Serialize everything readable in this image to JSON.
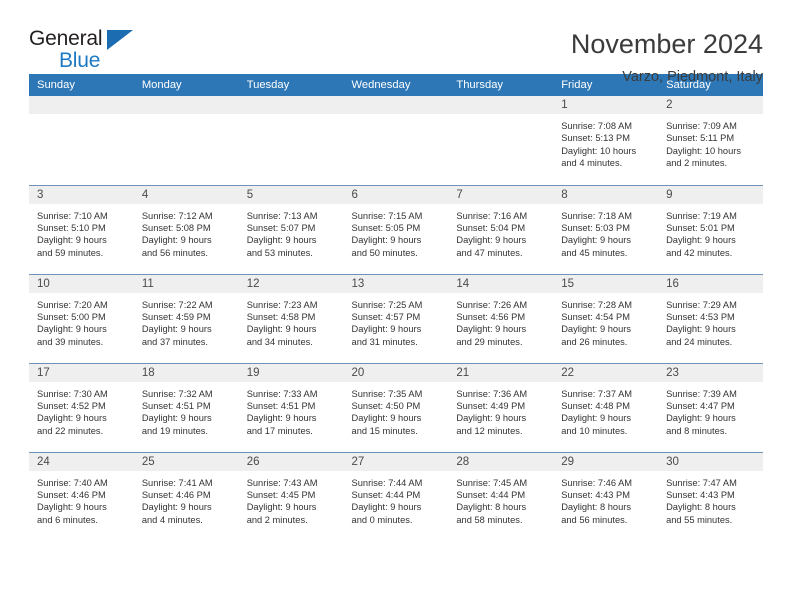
{
  "brand": {
    "name_part1": "General",
    "name_part2": "Blue",
    "triangle_icon": "triangle-icon",
    "accent_color": "#1f7ac4",
    "header_color": "#2d77b6"
  },
  "header": {
    "title": "November 2024",
    "subtitle": "Varzo, Piedmont, Italy"
  },
  "calendar": {
    "weekday_headers": [
      "Sunday",
      "Monday",
      "Tuesday",
      "Wednesday",
      "Thursday",
      "Friday",
      "Saturday"
    ],
    "weeks": [
      [
        {
          "day": "",
          "empty": true,
          "lines": []
        },
        {
          "day": "",
          "empty": true,
          "lines": []
        },
        {
          "day": "",
          "empty": true,
          "lines": []
        },
        {
          "day": "",
          "empty": true,
          "lines": []
        },
        {
          "day": "",
          "empty": true,
          "lines": []
        },
        {
          "day": "1",
          "sunrise": "Sunrise: 7:08 AM",
          "sunset": "Sunset: 5:13 PM",
          "daylight1": "Daylight: 10 hours",
          "daylight2": "and 4 minutes."
        },
        {
          "day": "2",
          "sunrise": "Sunrise: 7:09 AM",
          "sunset": "Sunset: 5:11 PM",
          "daylight1": "Daylight: 10 hours",
          "daylight2": "and 2 minutes."
        }
      ],
      [
        {
          "day": "3",
          "sunrise": "Sunrise: 7:10 AM",
          "sunset": "Sunset: 5:10 PM",
          "daylight1": "Daylight: 9 hours",
          "daylight2": "and 59 minutes."
        },
        {
          "day": "4",
          "sunrise": "Sunrise: 7:12 AM",
          "sunset": "Sunset: 5:08 PM",
          "daylight1": "Daylight: 9 hours",
          "daylight2": "and 56 minutes."
        },
        {
          "day": "5",
          "sunrise": "Sunrise: 7:13 AM",
          "sunset": "Sunset: 5:07 PM",
          "daylight1": "Daylight: 9 hours",
          "daylight2": "and 53 minutes."
        },
        {
          "day": "6",
          "sunrise": "Sunrise: 7:15 AM",
          "sunset": "Sunset: 5:05 PM",
          "daylight1": "Daylight: 9 hours",
          "daylight2": "and 50 minutes."
        },
        {
          "day": "7",
          "sunrise": "Sunrise: 7:16 AM",
          "sunset": "Sunset: 5:04 PM",
          "daylight1": "Daylight: 9 hours",
          "daylight2": "and 47 minutes."
        },
        {
          "day": "8",
          "sunrise": "Sunrise: 7:18 AM",
          "sunset": "Sunset: 5:03 PM",
          "daylight1": "Daylight: 9 hours",
          "daylight2": "and 45 minutes."
        },
        {
          "day": "9",
          "sunrise": "Sunrise: 7:19 AM",
          "sunset": "Sunset: 5:01 PM",
          "daylight1": "Daylight: 9 hours",
          "daylight2": "and 42 minutes."
        }
      ],
      [
        {
          "day": "10",
          "sunrise": "Sunrise: 7:20 AM",
          "sunset": "Sunset: 5:00 PM",
          "daylight1": "Daylight: 9 hours",
          "daylight2": "and 39 minutes."
        },
        {
          "day": "11",
          "sunrise": "Sunrise: 7:22 AM",
          "sunset": "Sunset: 4:59 PM",
          "daylight1": "Daylight: 9 hours",
          "daylight2": "and 37 minutes."
        },
        {
          "day": "12",
          "sunrise": "Sunrise: 7:23 AM",
          "sunset": "Sunset: 4:58 PM",
          "daylight1": "Daylight: 9 hours",
          "daylight2": "and 34 minutes."
        },
        {
          "day": "13",
          "sunrise": "Sunrise: 7:25 AM",
          "sunset": "Sunset: 4:57 PM",
          "daylight1": "Daylight: 9 hours",
          "daylight2": "and 31 minutes."
        },
        {
          "day": "14",
          "sunrise": "Sunrise: 7:26 AM",
          "sunset": "Sunset: 4:56 PM",
          "daylight1": "Daylight: 9 hours",
          "daylight2": "and 29 minutes."
        },
        {
          "day": "15",
          "sunrise": "Sunrise: 7:28 AM",
          "sunset": "Sunset: 4:54 PM",
          "daylight1": "Daylight: 9 hours",
          "daylight2": "and 26 minutes."
        },
        {
          "day": "16",
          "sunrise": "Sunrise: 7:29 AM",
          "sunset": "Sunset: 4:53 PM",
          "daylight1": "Daylight: 9 hours",
          "daylight2": "and 24 minutes."
        }
      ],
      [
        {
          "day": "17",
          "sunrise": "Sunrise: 7:30 AM",
          "sunset": "Sunset: 4:52 PM",
          "daylight1": "Daylight: 9 hours",
          "daylight2": "and 22 minutes."
        },
        {
          "day": "18",
          "sunrise": "Sunrise: 7:32 AM",
          "sunset": "Sunset: 4:51 PM",
          "daylight1": "Daylight: 9 hours",
          "daylight2": "and 19 minutes."
        },
        {
          "day": "19",
          "sunrise": "Sunrise: 7:33 AM",
          "sunset": "Sunset: 4:51 PM",
          "daylight1": "Daylight: 9 hours",
          "daylight2": "and 17 minutes."
        },
        {
          "day": "20",
          "sunrise": "Sunrise: 7:35 AM",
          "sunset": "Sunset: 4:50 PM",
          "daylight1": "Daylight: 9 hours",
          "daylight2": "and 15 minutes."
        },
        {
          "day": "21",
          "sunrise": "Sunrise: 7:36 AM",
          "sunset": "Sunset: 4:49 PM",
          "daylight1": "Daylight: 9 hours",
          "daylight2": "and 12 minutes."
        },
        {
          "day": "22",
          "sunrise": "Sunrise: 7:37 AM",
          "sunset": "Sunset: 4:48 PM",
          "daylight1": "Daylight: 9 hours",
          "daylight2": "and 10 minutes."
        },
        {
          "day": "23",
          "sunrise": "Sunrise: 7:39 AM",
          "sunset": "Sunset: 4:47 PM",
          "daylight1": "Daylight: 9 hours",
          "daylight2": "and 8 minutes."
        }
      ],
      [
        {
          "day": "24",
          "sunrise": "Sunrise: 7:40 AM",
          "sunset": "Sunset: 4:46 PM",
          "daylight1": "Daylight: 9 hours",
          "daylight2": "and 6 minutes."
        },
        {
          "day": "25",
          "sunrise": "Sunrise: 7:41 AM",
          "sunset": "Sunset: 4:46 PM",
          "daylight1": "Daylight: 9 hours",
          "daylight2": "and 4 minutes."
        },
        {
          "day": "26",
          "sunrise": "Sunrise: 7:43 AM",
          "sunset": "Sunset: 4:45 PM",
          "daylight1": "Daylight: 9 hours",
          "daylight2": "and 2 minutes."
        },
        {
          "day": "27",
          "sunrise": "Sunrise: 7:44 AM",
          "sunset": "Sunset: 4:44 PM",
          "daylight1": "Daylight: 9 hours",
          "daylight2": "and 0 minutes."
        },
        {
          "day": "28",
          "sunrise": "Sunrise: 7:45 AM",
          "sunset": "Sunset: 4:44 PM",
          "daylight1": "Daylight: 8 hours",
          "daylight2": "and 58 minutes."
        },
        {
          "day": "29",
          "sunrise": "Sunrise: 7:46 AM",
          "sunset": "Sunset: 4:43 PM",
          "daylight1": "Daylight: 8 hours",
          "daylight2": "and 56 minutes."
        },
        {
          "day": "30",
          "sunrise": "Sunrise: 7:47 AM",
          "sunset": "Sunset: 4:43 PM",
          "daylight1": "Daylight: 8 hours",
          "daylight2": "and 55 minutes."
        }
      ]
    ]
  }
}
